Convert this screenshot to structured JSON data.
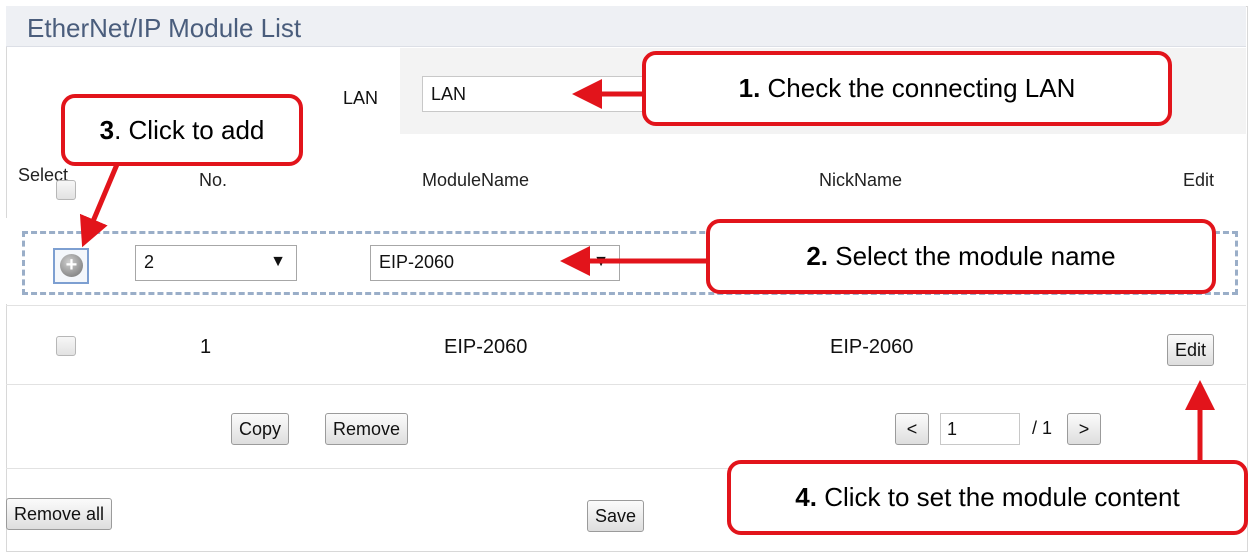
{
  "page": {
    "title": "EtherNet/IP Module List",
    "lan_label": "LAN",
    "lan_value": "LAN"
  },
  "table": {
    "headers": {
      "select": "Select",
      "no": "No.",
      "module_name": "ModuleName",
      "nick_name": "NickName",
      "edit": "Edit"
    },
    "new_row": {
      "add_icon": "plus-icon",
      "number": "2",
      "module": "EIP-2060"
    },
    "rows": [
      {
        "no": "1",
        "module_name": "EIP-2060",
        "nick_name": "EIP-2060",
        "edit_label": "Edit"
      }
    ]
  },
  "pager": {
    "copy_label": "Copy",
    "remove_label": "Remove",
    "prev_label": "<",
    "page_value": "1",
    "page_total": "/ 1",
    "next_label": ">"
  },
  "footer": {
    "remove_all_label": "Remove all",
    "save_label": "Save"
  },
  "callouts": {
    "c1": {
      "num": "1.",
      "text": " Check the connecting LAN"
    },
    "c2": {
      "num": "2.",
      "text": " Select the module name"
    },
    "c3": {
      "num": "3",
      "text": ". Click to add"
    },
    "c4": {
      "num": "4.",
      "text": " Click to set the module content"
    }
  },
  "colors": {
    "callout_red": "#e2141b",
    "title_blue": "#4a5d7c",
    "dashed_border": "#9aaec8"
  }
}
